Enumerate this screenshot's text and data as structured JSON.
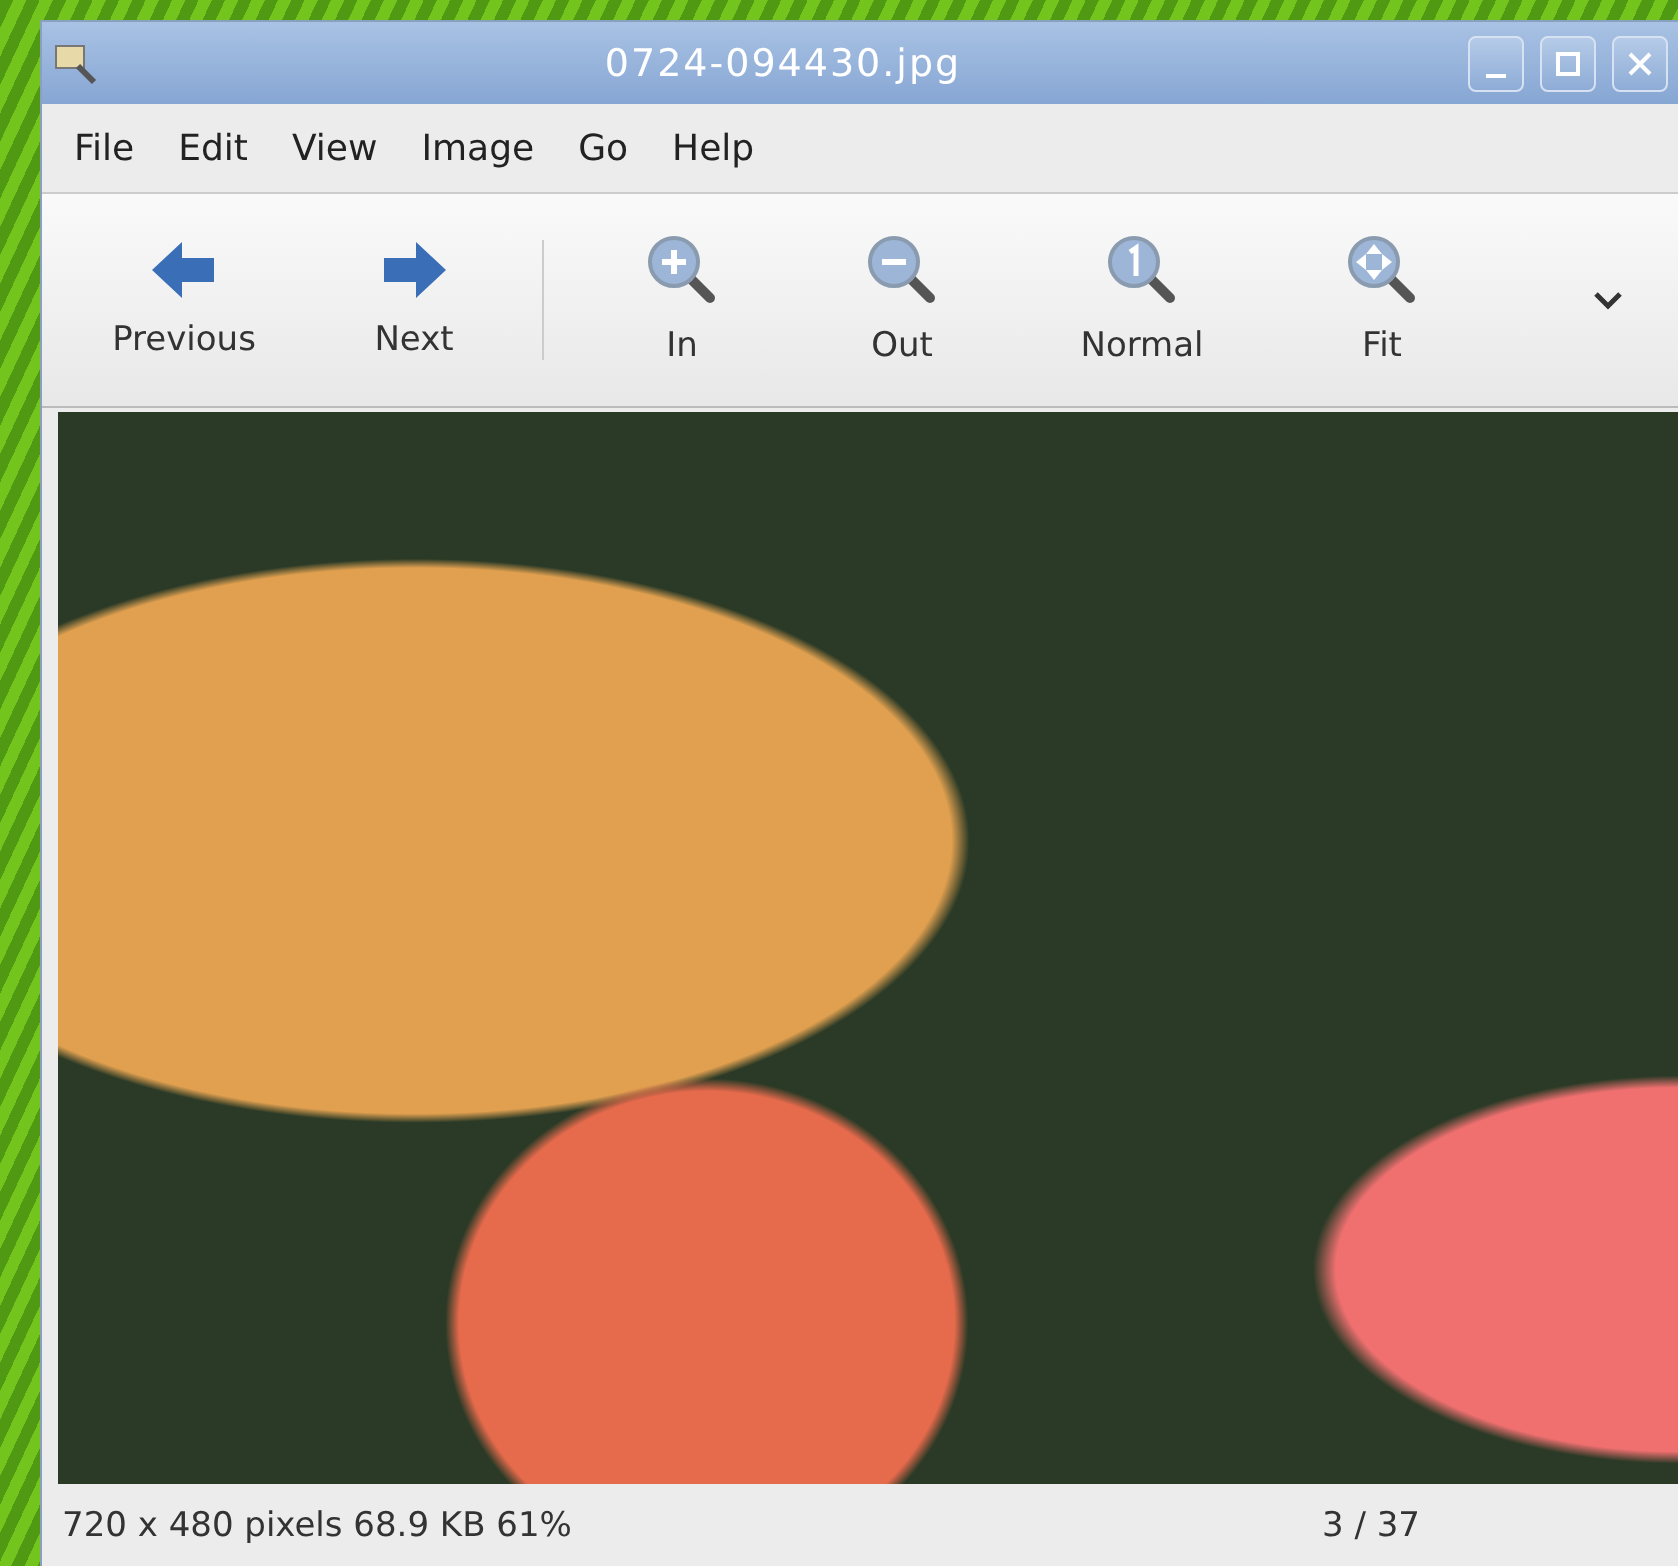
{
  "window": {
    "title": "0724-094430.jpg"
  },
  "menu": [
    "File",
    "Edit",
    "View",
    "Image",
    "Go",
    "Help"
  ],
  "toolbar": [
    {
      "kind": "back",
      "label": "Previous"
    },
    {
      "kind": "forward",
      "label": "Next"
    },
    {
      "kind": "separator"
    },
    {
      "kind": "zoomin",
      "label": "In"
    },
    {
      "kind": "zoomout",
      "label": "Out"
    },
    {
      "kind": "zoomnormal",
      "label": "Normal"
    },
    {
      "kind": "zoomfit",
      "label": "Fit"
    },
    {
      "kind": "overflow"
    }
  ],
  "status_bar": {
    "info": "720 x 480 pixels 68.9 KB 61%",
    "position": "3 / 37"
  }
}
